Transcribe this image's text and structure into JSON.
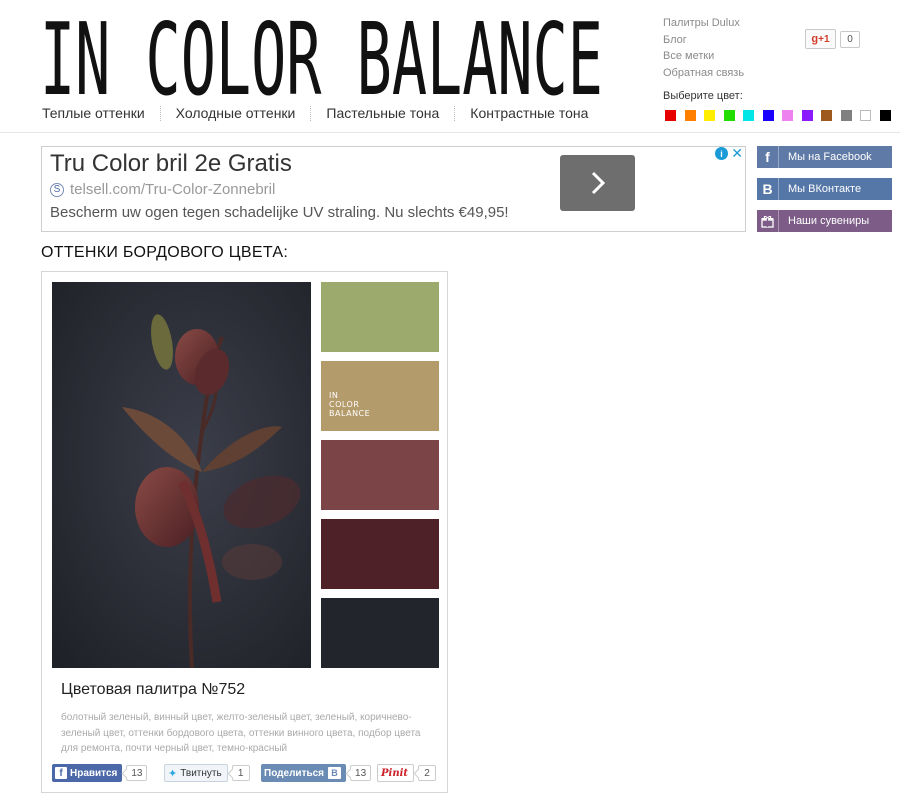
{
  "logo": {
    "text": "IN COLOR BALANCE"
  },
  "top_links": [
    "Палитры Dulux",
    "Блог",
    "Все метки",
    "Обратная связь"
  ],
  "gplus": {
    "label": "+1",
    "count": "0"
  },
  "color_picker": {
    "label": "Выберите цвет:",
    "colors": [
      "#e60000",
      "#ff8000",
      "#ffee00",
      "#22dd00",
      "#00e5e5",
      "#1a00ff",
      "#ee82ee",
      "#8a1aff",
      "#9e5a1e",
      "#808080",
      "#ffffff",
      "#000000"
    ]
  },
  "nav": [
    "Теплые оттенки",
    "Холодные оттенки",
    "Пастельные тона",
    "Контрастные тона"
  ],
  "ad": {
    "title": "Tru Color bril 2e Gratis",
    "url": "telsell.com/Tru-Color-Zonnebril",
    "description": "Bescherm uw ogen tegen schadelijke UV straling. Nu slechts €49,95!",
    "info": "i",
    "close": "✕"
  },
  "social": {
    "facebook": "Мы на Facebook",
    "vk": "Мы ВКонтакте",
    "gifts": "Наши сувениры"
  },
  "section_title": "ОТТЕНКИ БОРДОВОГО ЦВЕТА:",
  "palette": {
    "colors": [
      "#9caa6e",
      "#b49b6b",
      "#7b4548",
      "#4e2129",
      "#23252c"
    ],
    "logo_lines": [
      "IN",
      "COLOR",
      "BALANCE"
    ],
    "title": "Цветовая палитра №752",
    "tags": "болотный зеленый, винный цвет, желто-зеленый цвет, зеленый, коричнево-зеленый цвет, оттенки бордового цвета, оттенки винного цвета, подбор цвета для ремонта, почти черный цвет, темно-красный"
  },
  "share": {
    "fb_label": "Нравится",
    "fb_count": "13",
    "tw_label": "Твитнуть",
    "tw_count": "1",
    "vk_label": "Поделиться",
    "vk_count": "13",
    "pin_label": "Pinit",
    "pin_count": "2"
  }
}
